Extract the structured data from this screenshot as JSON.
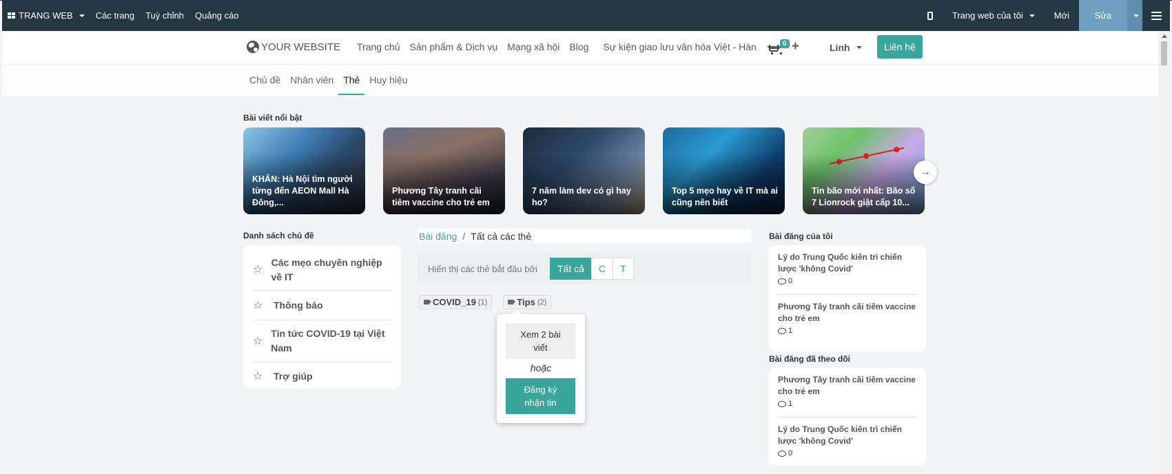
{
  "admin_bar": {
    "brand": "TRANG WEB",
    "menu": [
      "Các trang",
      "Tuỳ chỉnh",
      "Quảng cáo"
    ],
    "website_selector": "Trang web của tôi",
    "new_label": "Mới",
    "edit_label": "Sửa"
  },
  "header": {
    "logo": "YOUR WEBSITE",
    "nav": [
      "Trang chủ",
      "Sản phẩm & Dịch vụ",
      "Mạng xã hội",
      "Blog",
      "Sự kiện giao lưu văn hóa Việt - Hàn"
    ],
    "cart_count": "0",
    "user": "Linh",
    "contact": "Liên hệ"
  },
  "subnav": {
    "tabs": [
      "Chủ đề",
      "Nhân viên",
      "Thẻ",
      "Huy hiệu"
    ],
    "active": "Thẻ"
  },
  "featured": {
    "title": "Bài viết nổi bật",
    "cards": [
      "KHẨN: Hà Nội tìm người từng đến AEON Mall Hà Đông,...",
      "Phương Tây tranh cãi tiêm vaccine cho trẻ em",
      "7 năm làm dev có gì hay ho?",
      "Top 5 mẹo hay về IT mà ai cũng nên biết",
      "Tin bão mới nhất: Bão số 7 Lionrock giật cấp 10..."
    ]
  },
  "topics": {
    "title": "Danh sách chủ đề",
    "items": [
      "Các mẹo chuyên nghiệp về IT",
      "Thông báo",
      "Tin tức COVID-19 tại Việt Nam",
      "Trợ giúp"
    ]
  },
  "breadcrumb": {
    "parent": "Bài đăng",
    "current": "Tất cả các thẻ"
  },
  "filter": {
    "label": "Hiển thị các thẻ bắt đầu bởi",
    "options": [
      "Tất cả",
      "C",
      "T"
    ],
    "active": "Tất cả"
  },
  "tags": [
    {
      "name": "COVID_19",
      "count": "(1)"
    },
    {
      "name": "Tips",
      "count": "(2)"
    }
  ],
  "popover": {
    "view": "Xem 2 bài viết",
    "or": "hoặc",
    "subscribe": "Đăng ký nhận tin"
  },
  "my_posts": {
    "title": "Bài đăng của tôi",
    "items": [
      {
        "title": "Lý do Trung Quốc kiên trì chiến lược 'không Covid'",
        "comments": "0"
      },
      {
        "title": "Phương Tây tranh cãi tiêm vaccine cho trẻ em",
        "comments": "1"
      }
    ]
  },
  "followed_posts": {
    "title": "Bài đăng đã theo dõi",
    "items": [
      {
        "title": "Phương Tây tranh cãi tiêm vaccine cho trẻ em",
        "comments": "1"
      },
      {
        "title": "Lý do Trung Quốc kiên trì chiến lược 'không Covid'",
        "comments": "0"
      }
    ]
  },
  "colors": {
    "accent": "#38a69b",
    "admin_bar": "#243742",
    "edit_button": "#6f9fc0"
  }
}
